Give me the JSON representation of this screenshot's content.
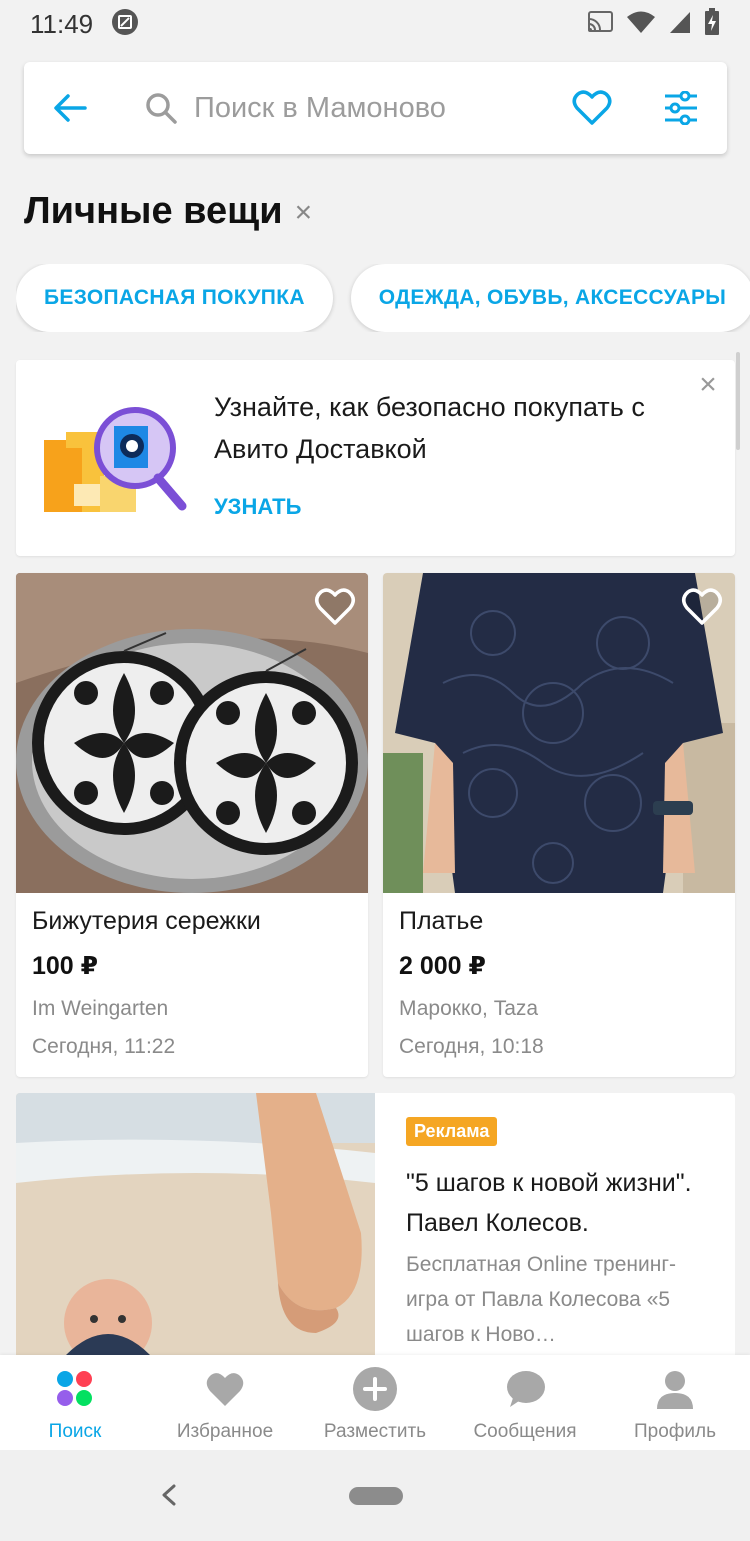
{
  "status_bar": {
    "time": "11:49",
    "icons": [
      "screenshot-notification-icon",
      "cast-icon",
      "wifi-icon",
      "cell-signal-icon",
      "battery-charging-icon"
    ]
  },
  "search": {
    "placeholder": "Поиск в Мамоново",
    "icons": [
      "back-arrow-icon",
      "search-icon",
      "heart-icon",
      "filter-icon"
    ]
  },
  "category": {
    "title": "Личные вещи",
    "clear_glyph": "×"
  },
  "chips": [
    {
      "label": "БЕЗОПАСНАЯ ПОКУПКА"
    },
    {
      "label": "ОДЕЖДА, ОБУВЬ, АКСЕССУАРЫ"
    }
  ],
  "promo": {
    "text": "Узнайте, как безопасно покупать с Авито Доставкой",
    "link": "УЗНАТЬ",
    "close_glyph": "×"
  },
  "items": [
    {
      "title": "Бижутерия сережки",
      "price": "100 ₽",
      "location": "Im Weingarten",
      "date": "Сегодня, 11:22"
    },
    {
      "title": "Платье",
      "price": "2 000 ₽",
      "location": "Марокко, Taza",
      "date": "Сегодня, 10:18"
    }
  ],
  "ad": {
    "badge": "Реклама",
    "title": "\"5 шагов к новой жизни\". Павел Колесов.",
    "description": "Бесплатная Online тренинг-игра от Павла Колесова «5 шагов к Ново…"
  },
  "bottom_nav": [
    {
      "label": "Поиск",
      "icon": "search-dots-icon",
      "active": true
    },
    {
      "label": "Избранное",
      "icon": "heart-icon",
      "active": false
    },
    {
      "label": "Разместить",
      "icon": "plus-circle-icon",
      "active": false
    },
    {
      "label": "Сообщения",
      "icon": "chat-bubble-icon",
      "active": false
    },
    {
      "label": "Профиль",
      "icon": "person-icon",
      "active": false
    }
  ],
  "colors": {
    "accent": "#0aa6e6",
    "ad_badge": "#f5a623",
    "background": "#f2f2f2"
  }
}
